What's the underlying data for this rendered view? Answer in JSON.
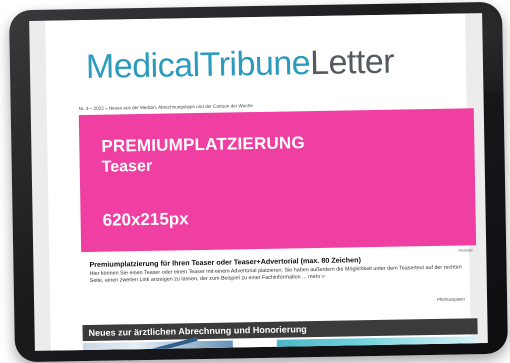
{
  "newsletter": {
    "logo": {
      "part1": "Medical",
      "part2": "Tribune",
      "part3": "Letter"
    },
    "issue_line": "Nr. 4 – 2022 – Neues aus der Medizin, Abrechnungstipps und der Cartoon der Woche",
    "banner": {
      "line1": "PREMIUMPLATZIERUNG",
      "line2": "Teaser",
      "line3": "620x215px",
      "ad_label": "Anzeige",
      "color": "#ef3fa2"
    },
    "teaser": {
      "title": "Premiumplatzierung für Ihren Teaser oder Teaser+Advertorial (max. 80 Zeichen)",
      "body": "Hier können Sie einen Teaser oder einen Teaser mit einem Advertorial platzieren. Sie haben außerdem die Möglichkeit unter dem Teasertext auf der rechten Seite, einen zweiten Link anzeigen zu lassen, der zum Beispiel zu einer Fachinformation ... mehr »",
      "pflicht": "Pflichtangaben"
    },
    "section": {
      "title": "Neues zur ärztlichen Abrechnung und Honorierung"
    }
  },
  "colors": {
    "brand_blue": "#2a9bbd",
    "logo_grey": "#555a60",
    "section_bar": "#3b3b3b"
  }
}
